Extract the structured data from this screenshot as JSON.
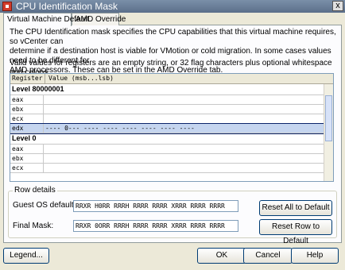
{
  "window": {
    "title": "CPU Identification Mask",
    "close_glyph": "x"
  },
  "tabs": [
    {
      "label": "Virtual Machine Default"
    },
    {
      "label": "AMD Override"
    }
  ],
  "description": {
    "line1": "The CPU Identification mask specifies the CPU capabilities that this virtual machine requires, so vCenter can",
    "line2": "determine if a destination host is viable for VMotion or cold migration. In some cases values need to be different for",
    "line3": "AMD processors. These can be set in the AMD Override tab.",
    "valid": "Valid values for registers are an empty string, or 32 flag characters plus optional whitespace and colons."
  },
  "grid": {
    "columns": {
      "register": "Register",
      "value": "Value (msb...lsb)"
    },
    "rows": [
      {
        "kind": "level",
        "label": "Level 80000001"
      },
      {
        "kind": "reg",
        "register": "eax",
        "value": ""
      },
      {
        "kind": "reg",
        "register": "ebx",
        "value": ""
      },
      {
        "kind": "reg",
        "register": "ecx",
        "value": ""
      },
      {
        "kind": "reg",
        "register": "edx",
        "value": "---- 0--- ---- ---- ---- ---- ---- ----",
        "selected": true
      },
      {
        "kind": "level",
        "label": "Level 0"
      },
      {
        "kind": "reg",
        "register": "eax",
        "value": ""
      },
      {
        "kind": "reg",
        "register": "ebx",
        "value": ""
      },
      {
        "kind": "reg",
        "register": "ecx",
        "value": ""
      }
    ]
  },
  "row_details": {
    "group_label": "Row details",
    "guest_os_label": "Guest OS default:",
    "guest_os_value": "RRXR H0RR RRRH RRRR RRRR XRRR RRRR RRRR",
    "final_mask_label": "Final Mask:",
    "final_mask_value": "RRXR 0ORR RRRH RRRR RRRR XRRR RRRR RRRR",
    "reset_all_label": "Reset All to Default",
    "reset_row_label": "Reset Row to Default"
  },
  "footer": {
    "legend_label": "Legend...",
    "ok_label": "OK",
    "cancel_label": "Cancel",
    "help_label": "Help"
  }
}
